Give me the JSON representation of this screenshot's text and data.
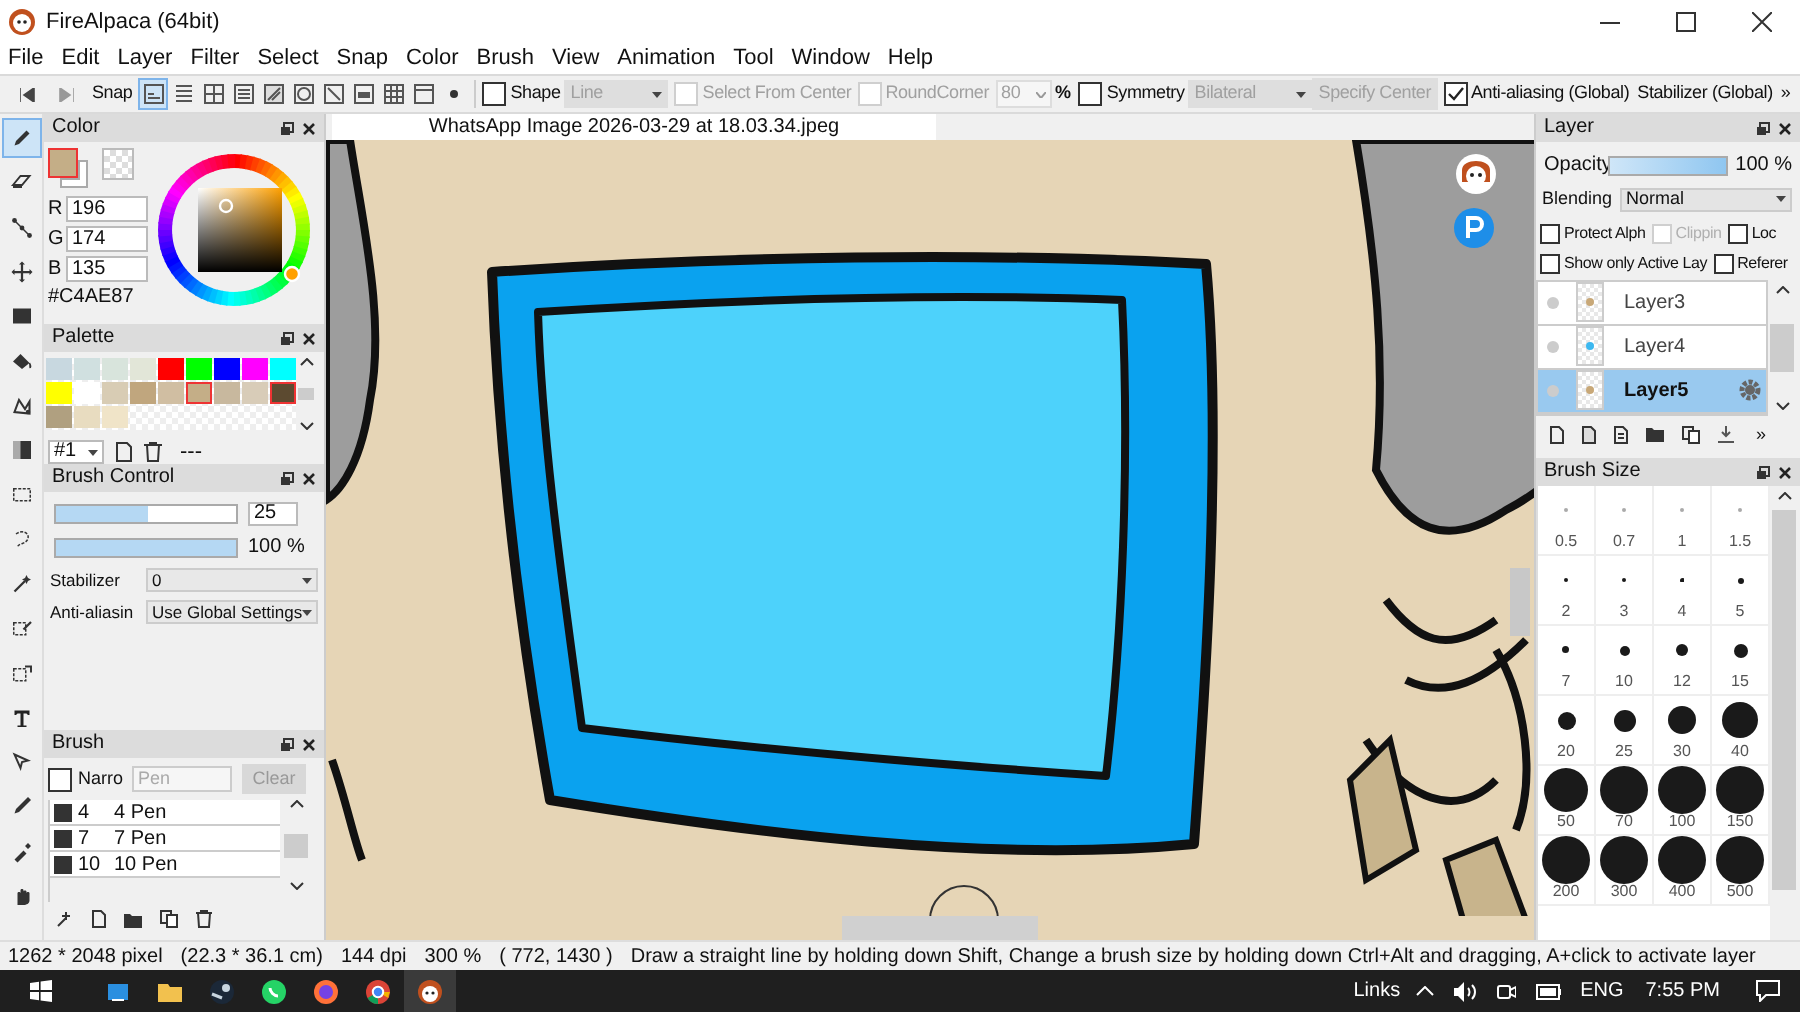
{
  "window": {
    "title": "FireAlpaca (64bit)"
  },
  "menu": [
    "File",
    "Edit",
    "Layer",
    "Filter",
    "Select",
    "Snap",
    "Color",
    "Brush",
    "View",
    "Animation",
    "Tool",
    "Window",
    "Help"
  ],
  "toolbar": {
    "snap_label": "Snap",
    "snap_modes": [
      {
        "selected": true
      },
      {
        "selected": false
      },
      {
        "selected": false
      },
      {
        "selected": false
      },
      {
        "selected": false
      },
      {
        "selected": false
      },
      {
        "selected": false
      },
      {
        "selected": false
      },
      {
        "selected": false
      },
      {
        "selected": false
      },
      {
        "selected": false
      }
    ],
    "shape": {
      "label": "Shape",
      "checked": false
    },
    "shape_type": {
      "value": "Line",
      "disabled": true
    },
    "select_from_center": {
      "label": "Select From Center",
      "checked": false,
      "disabled": true
    },
    "round_corner": {
      "label": "RoundCorner",
      "checked": false,
      "disabled": true,
      "value": "80",
      "unit": "%"
    },
    "symmetry": {
      "label": "Symmetry",
      "checked": false
    },
    "symmetry_type": {
      "value": "Bilateral",
      "disabled": true
    },
    "specify_center": {
      "label": "Specify Center",
      "disabled": true
    },
    "anti_aliasing": {
      "label": "Anti-aliasing (Global)",
      "checked": true
    },
    "stabilizer": {
      "label": "Stabilizer (Global)"
    },
    "overflow": "»"
  },
  "tools": [
    {
      "selected": true
    },
    {
      "selected": false
    },
    {
      "selected": false
    },
    {
      "selected": false
    },
    {
      "selected": false
    },
    {
      "selected": false
    },
    {
      "selected": false
    },
    {
      "selected": false
    },
    {
      "selected": false
    },
    {
      "selected": false
    },
    {
      "selected": false
    },
    {
      "selected": false
    },
    {
      "selected": false
    },
    {
      "selected": false
    },
    {
      "selected": false
    },
    {
      "selected": false
    },
    {
      "selected": false
    },
    {
      "selected": false
    }
  ],
  "color": {
    "title": "Color",
    "foreground": {
      "color": "#c4ae87"
    },
    "channels": [
      {
        "label": "R",
        "value": "196"
      },
      {
        "label": "G",
        "value": "174"
      },
      {
        "label": "B",
        "value": "135"
      }
    ],
    "hex": "#C4AE87"
  },
  "palette": {
    "title": "Palette",
    "swatches": [
      {
        "color": "#c8d8e0",
        "selected": false
      },
      {
        "color": "#d0e0e0",
        "selected": false
      },
      {
        "color": "#d8e4dc",
        "selected": false
      },
      {
        "color": "#e2e6d8",
        "selected": false
      },
      {
        "color": "#ff0000",
        "selected": false
      },
      {
        "color": "#00ff00",
        "selected": false
      },
      {
        "color": "#0000ff",
        "selected": false
      },
      {
        "color": "#ff00ff",
        "selected": false
      },
      {
        "color": "#00ffff",
        "selected": false
      },
      {
        "color": "#ffff00",
        "selected": false
      },
      {
        "color": "#ffffff",
        "selected": false
      },
      {
        "color": "#d8ccb4",
        "selected": false
      },
      {
        "color": "#c0a67e",
        "selected": false
      },
      {
        "color": "#d0bea2",
        "selected": false
      },
      {
        "color": "#c4ae87",
        "selected": true
      },
      {
        "color": "#c8b89e",
        "selected": false
      },
      {
        "color": "#d8ccb8",
        "selected": false
      },
      {
        "color": "#5c4a30",
        "selected": true
      },
      {
        "color": "#b0a080",
        "selected": false
      },
      {
        "color": "#e8dcc0",
        "selected": false
      },
      {
        "color": "#f0e4c8",
        "selected": false
      }
    ],
    "set": "#1",
    "separator": "---"
  },
  "brush_control": {
    "title": "Brush Control",
    "size": {
      "level": 0.51,
      "value": "25"
    },
    "opacity": {
      "level": 1,
      "value": "100 %"
    },
    "stabilizer": {
      "label": "Stabilizer",
      "value": "0"
    },
    "anti_aliasing": {
      "label": "Anti-aliasin",
      "value": "Use Global Settings"
    }
  },
  "brush": {
    "title": "Brush",
    "narrow": {
      "label": "Narro",
      "checked": false
    },
    "search": {
      "placeholder": "Pen"
    },
    "clear": "Clear",
    "items": [
      {
        "size": "4",
        "name": "4 Pen",
        "selected": false
      },
      {
        "size": "7",
        "name": "7 Pen",
        "selected": false
      },
      {
        "size": "10",
        "name": "10 Pen",
        "selected": false
      }
    ]
  },
  "canvas": {
    "tab": "WhatsApp Image 2026-03-29 at 18.03.34.jpeg"
  },
  "layer": {
    "title": "Layer",
    "opacity": {
      "label": "Opacity",
      "level": 1,
      "value": "100 %"
    },
    "blending": {
      "label": "Blending",
      "value": "Normal"
    },
    "options": [
      {
        "label": "Protect Alph",
        "checked": false,
        "disabled": false
      },
      {
        "label": "Clippin",
        "checked": false,
        "disabled": true
      },
      {
        "label": "Loc",
        "checked": false,
        "disabled": false
      },
      {
        "label": "Show only Active Lay",
        "checked": false,
        "disabled": false
      },
      {
        "label": "Referer",
        "checked": false,
        "disabled": false
      }
    ],
    "layers": [
      {
        "name": "Layer3",
        "selected": false
      },
      {
        "name": "Layer4",
        "selected": false
      },
      {
        "name": "Layer5",
        "selected": true
      }
    ],
    "overflow": "»"
  },
  "brush_size": {
    "title": "Brush Size",
    "sizes": [
      "0.5",
      "0.7",
      "1",
      "1.5",
      "2",
      "3",
      "4",
      "5",
      "7",
      "10",
      "12",
      "15",
      "20",
      "25",
      "30",
      "40",
      "50",
      "70",
      "100",
      "150",
      "200",
      "300",
      "400",
      "500"
    ]
  },
  "status_bar": {
    "items": [
      "1262 * 2048 pixel",
      "(22.3 * 36.1 cm)",
      "144 dpi",
      "300 %",
      "( 772, 1430 )",
      "Draw a straight line by holding down Shift, Change a brush size by holding down Ctrl+Alt and dragging, A+click to activate layer"
    ]
  },
  "taskbar": {
    "links": "Links",
    "language": "ENG",
    "time": "7:55 PM"
  }
}
